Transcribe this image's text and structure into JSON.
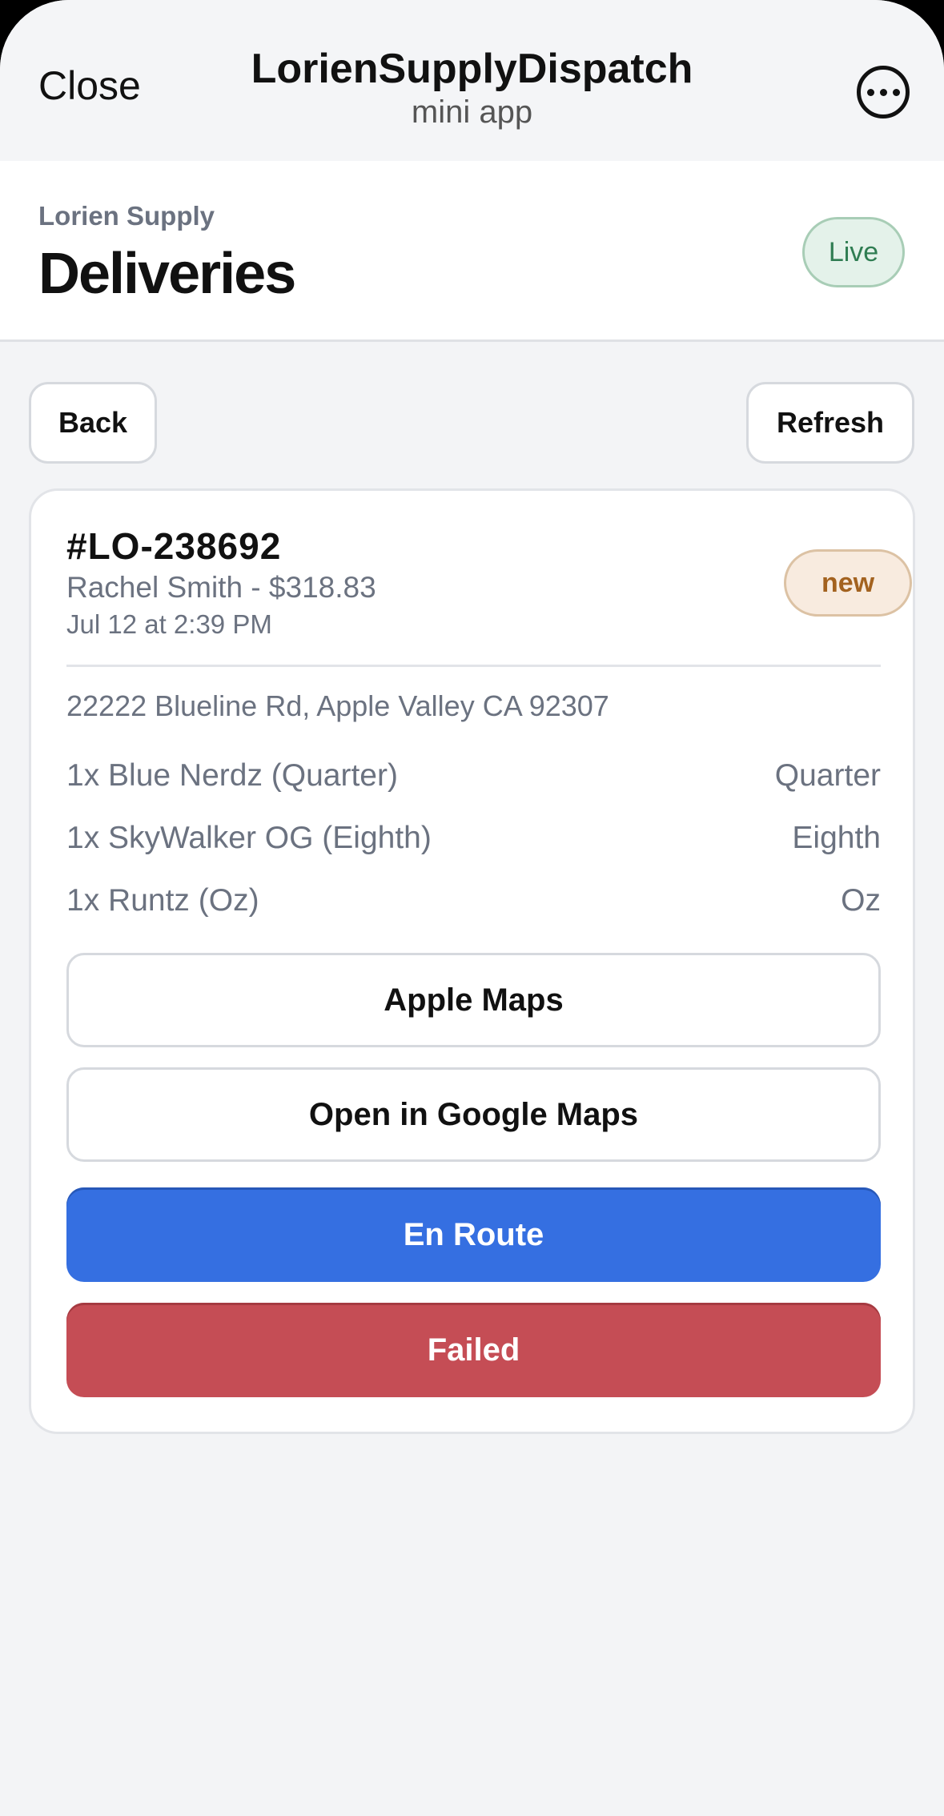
{
  "topbar": {
    "close_label": "Close",
    "title": "LorienSupplyDispatch",
    "subtitle": "mini app"
  },
  "header": {
    "brand": "Lorien Supply",
    "title": "Deliveries",
    "live_badge": "Live"
  },
  "actions": {
    "back_label": "Back",
    "refresh_label": "Refresh"
  },
  "order": {
    "id": "#LO-238692",
    "customer_line": "Rachel Smith - $318.83",
    "datetime": "Jul 12 at 2:39 PM",
    "status": "new",
    "address": "22222 Blueline Rd, Apple Valley CA 92307",
    "items": [
      {
        "name": "1x Blue Nerdz (Quarter)",
        "size": "Quarter"
      },
      {
        "name": "1x SkyWalker OG (Eighth)",
        "size": "Eighth"
      },
      {
        "name": "1x Runtz (Oz)",
        "size": "Oz"
      }
    ],
    "buttons": {
      "apple_maps": "Apple Maps",
      "google_maps": "Open in Google Maps",
      "en_route": "En Route",
      "failed": "Failed"
    }
  },
  "colors": {
    "primary": "#356fe1",
    "danger": "#c54d55",
    "live_badge_bg": "#e4f2ea",
    "status_new_bg": "#f8ebdf"
  }
}
